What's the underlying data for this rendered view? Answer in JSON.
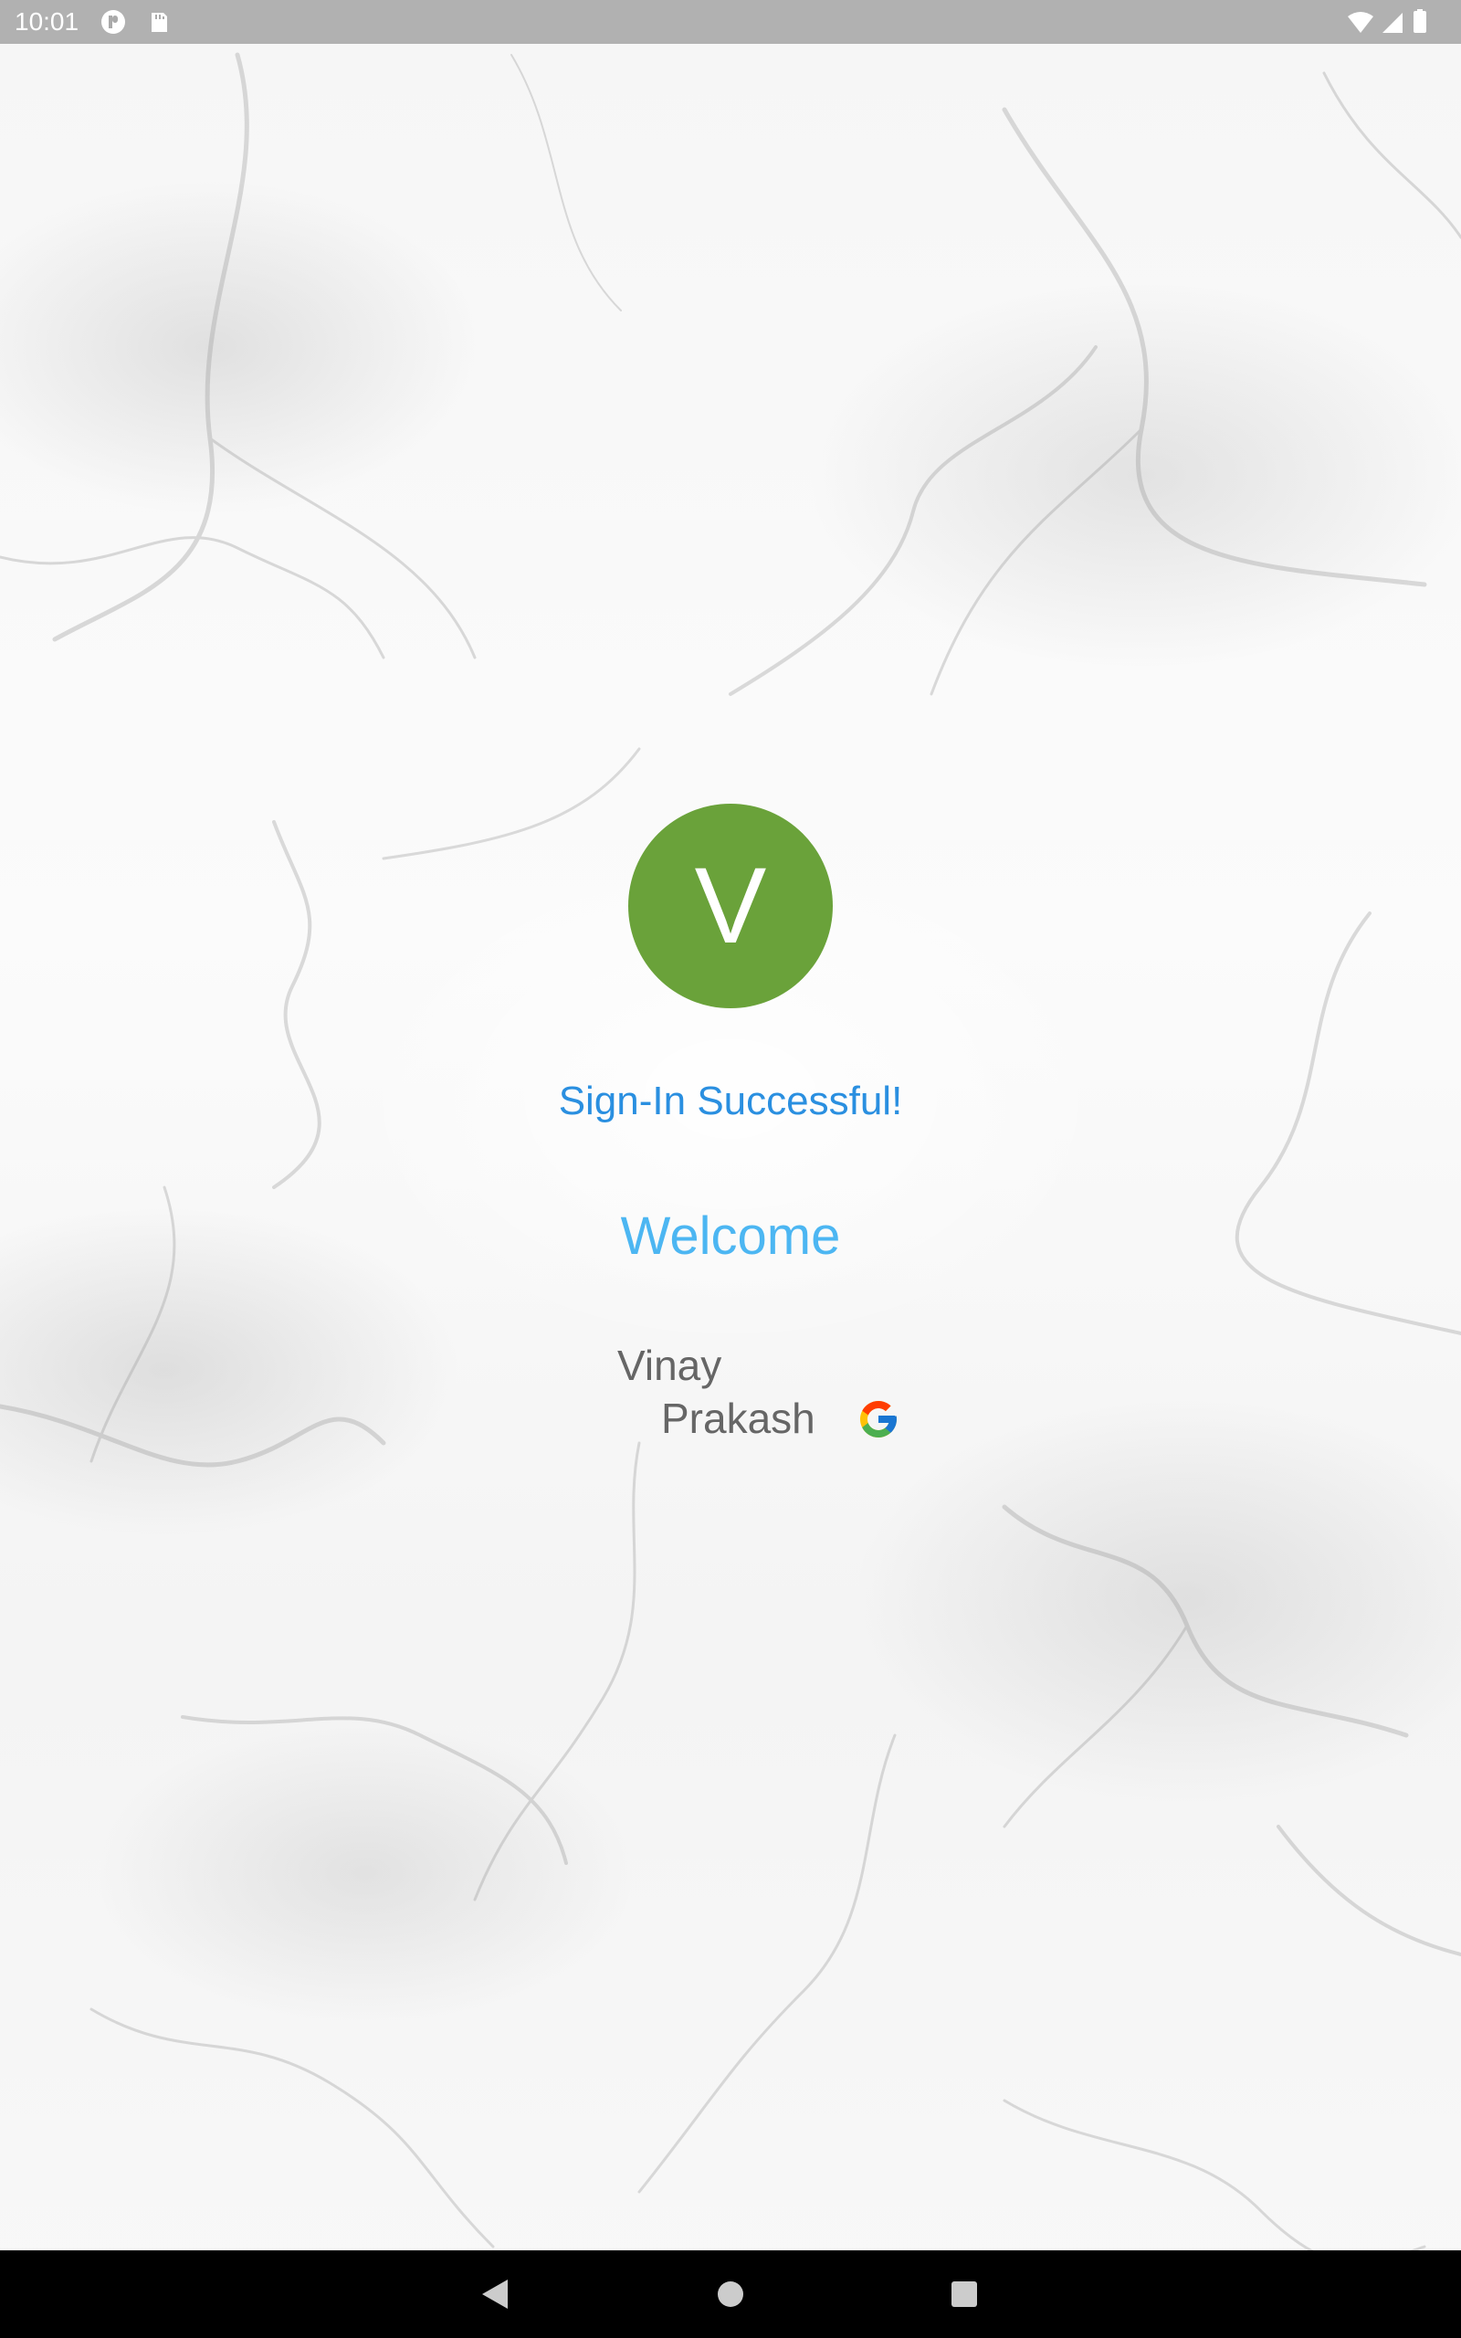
{
  "status_bar": {
    "time": "10:01"
  },
  "profile": {
    "avatar_initial": "V",
    "avatar_color": "#6aa23a"
  },
  "main": {
    "success_message": "Sign-In Successful!",
    "welcome_message": "Welcome",
    "first_name": "Vinay",
    "last_name": "Prakash",
    "provider_icon": "google-icon"
  },
  "colors": {
    "success_text": "#2a8fe0",
    "welcome_text": "#4cb6f2",
    "name_text": "#666666"
  },
  "nav_bar": {
    "back_icon": "back-icon",
    "home_icon": "home-icon",
    "recents_icon": "recents-icon"
  }
}
